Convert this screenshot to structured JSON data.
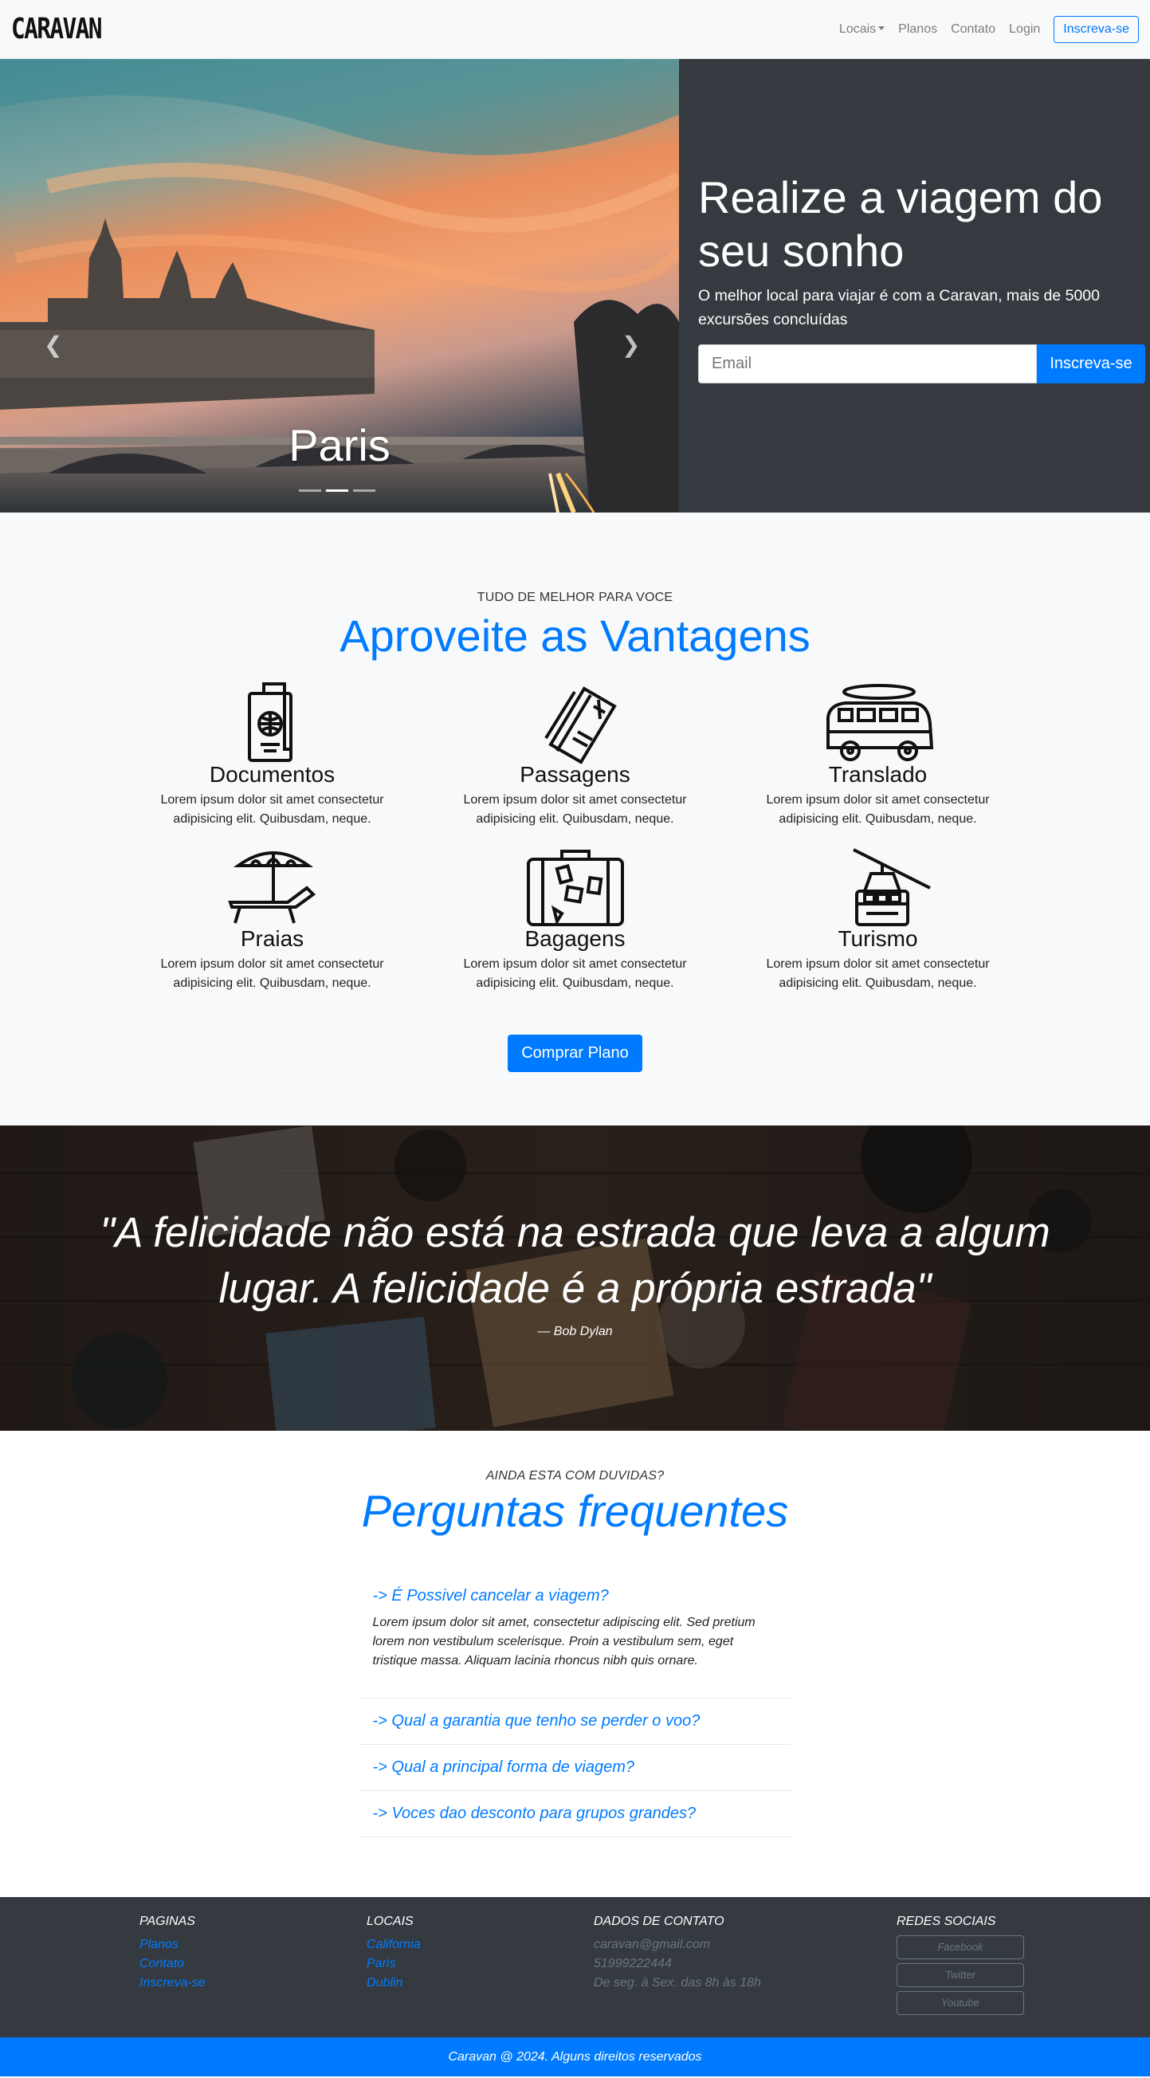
{
  "nav": {
    "brand": "CARAVAN",
    "links": [
      "Locais",
      "Planos",
      "Contato",
      "Login"
    ],
    "cta": "Inscreva-se"
  },
  "hero": {
    "slide_caption": "Paris",
    "title": "Realize a viagem do seu sonho",
    "subtitle": "O melhor local para viajar é com a Caravan, mais de 5000 excursões concluídas",
    "email_placeholder": "Email",
    "signup_button": "Inscreva-se"
  },
  "features": {
    "kicker": "TUDO DE MELHOR PARA VOCE",
    "title": "Aproveite as Vantagens",
    "items": [
      {
        "title": "Documentos",
        "text": "Lorem ipsum dolor sit amet consectetur adipisicing elit. Quibusdam, neque.",
        "icon": "passport-icon"
      },
      {
        "title": "Passagens",
        "text": "Lorem ipsum dolor sit amet consectetur adipisicing elit. Quibusdam, neque.",
        "icon": "ticket-icon"
      },
      {
        "title": "Translado",
        "text": "Lorem ipsum dolor sit amet consectetur adipisicing elit. Quibusdam, neque.",
        "icon": "van-icon"
      },
      {
        "title": "Praias",
        "text": "Lorem ipsum dolor sit amet consectetur adipisicing elit. Quibusdam, neque.",
        "icon": "beach-chair-icon"
      },
      {
        "title": "Bagagens",
        "text": "Lorem ipsum dolor sit amet consectetur adipisicing elit. Quibusdam, neque.",
        "icon": "suitcase-icon"
      },
      {
        "title": "Turismo",
        "text": "Lorem ipsum dolor sit amet consectetur adipisicing elit. Quibusdam, neque.",
        "icon": "cable-car-icon"
      }
    ],
    "button": "Comprar Plano"
  },
  "quote": {
    "text": "\"A felicidade não está na estrada que leva a algum lugar. A felicidade é a própria estrada\"",
    "author": "— Bob Dylan"
  },
  "faq": {
    "kicker": "AINDA ESTA COM DUVIDAS?",
    "title": "Perguntas frequentes",
    "items": [
      {
        "q": "-> É Possivel cancelar a viagem?",
        "a": "Lorem ipsum dolor sit amet, consectetur adipiscing elit. Sed pretium lorem non vestibulum scelerisque. Proin a vestibulum sem, eget tristique massa. Aliquam lacinia rhoncus nibh quis ornare."
      },
      {
        "q": "-> Qual a garantia que tenho se perder o voo?"
      },
      {
        "q": "-> Qual a principal forma de viagem?"
      },
      {
        "q": "-> Voces dao desconto para grupos grandes?"
      }
    ]
  },
  "footer": {
    "pages": {
      "title": "PAGINAS",
      "links": [
        "Planos",
        "Contato",
        "Inscreva-se"
      ]
    },
    "places": {
      "title": "LOCAIS",
      "links": [
        "California",
        "Paris",
        "Dublin"
      ]
    },
    "contact": {
      "title": "DADOS DE CONTATO",
      "lines": [
        "caravan@gmail.com",
        "51999222444",
        "De seg. à Sex. das 8h às 18h"
      ]
    },
    "social": {
      "title": "REDES SOCIAIS",
      "buttons": [
        "Facebook",
        "Twitter",
        "Youtube"
      ]
    },
    "copyright": "Caravan @ 2024. Alguns direitos reservados"
  },
  "colors": {
    "primary": "#007bff",
    "dark": "#343a40",
    "light": "#f8f9fa"
  }
}
